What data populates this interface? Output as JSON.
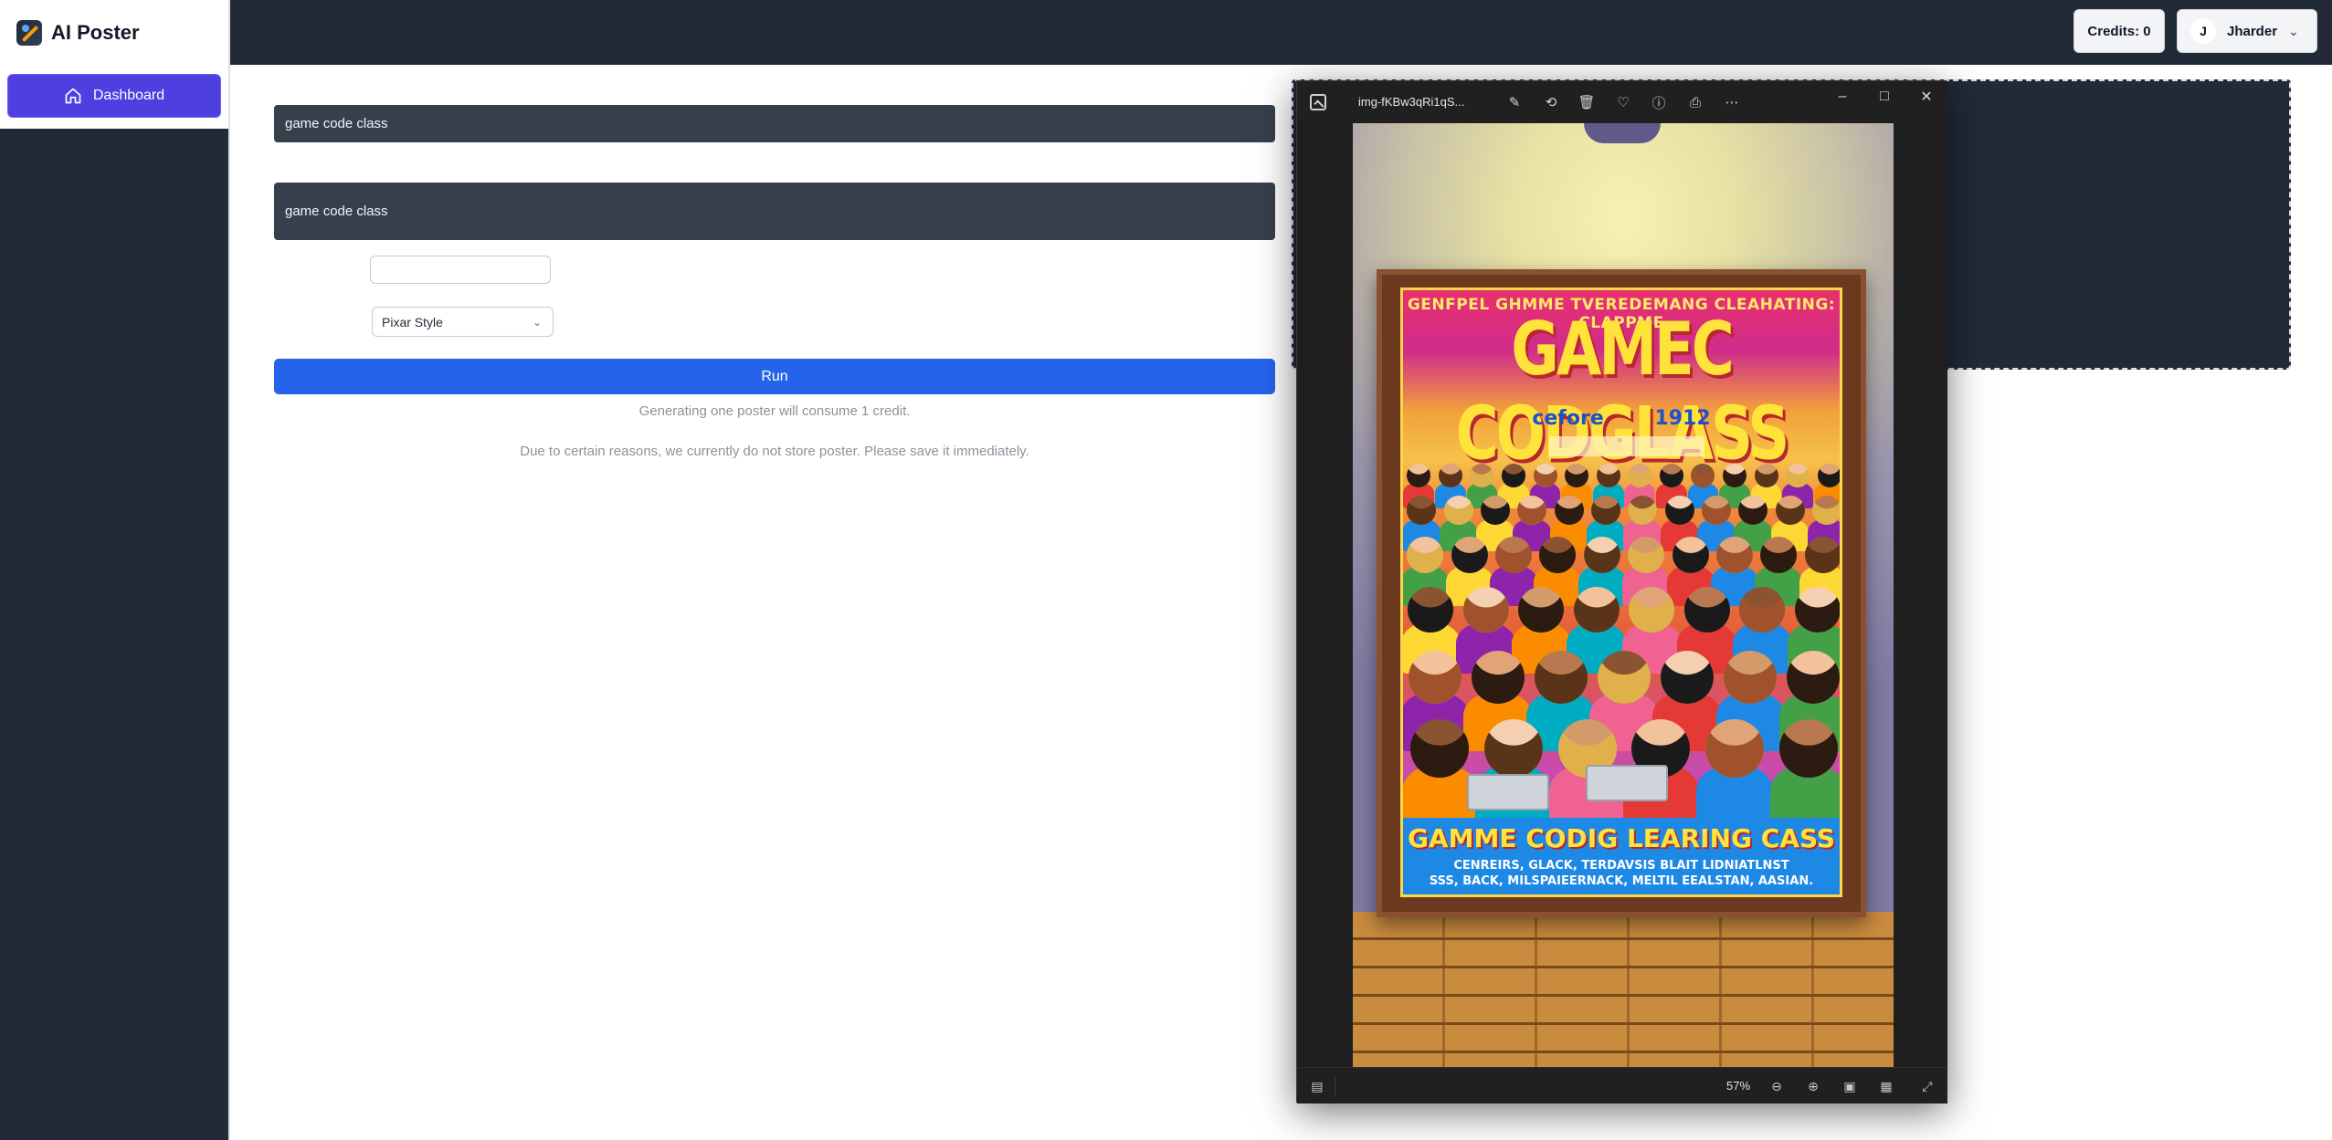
{
  "brand": {
    "name": "AI Poster"
  },
  "sidebar": {
    "items": [
      {
        "label": "Dashboard"
      }
    ]
  },
  "header": {
    "credits": "Credits: 0",
    "user_initial": "J",
    "user_name": "Jharder"
  },
  "form": {
    "field1_value": "game code class",
    "field2_value": "game code class",
    "small_input_value": "",
    "style_selected": "Pixar Style",
    "run_label": "Run",
    "note_credit": "Generating one poster will consume 1 credit.",
    "note_store": "Due to certain reasons, we currently do not store poster. Please save it immediately."
  },
  "viewer": {
    "filename": "img-fKBw3qRi1qS...",
    "zoom": "57%",
    "poster": {
      "top_text": "GENFPEL GHMME TVEREDEMANG CLEAHATING: CLAPPME",
      "title": "GAMEC CODGLASS",
      "subtitle": "cefore 1912",
      "bottom_title": "GAMME CODIG LEARING CASS",
      "bottom_line1": "CENREIRS, GLACK, TERDAVSIS BLAIT LIDNIATLNST",
      "bottom_line2": "SSS, BACK, MILSPAIEERNACK, MELTIL EEALSTAN, AASIAN."
    }
  },
  "colors": {
    "sidebar_bg": "#222a37",
    "primary": "#2563eb",
    "nav_active": "#4f3fe0",
    "field_bg": "#373f4d"
  }
}
